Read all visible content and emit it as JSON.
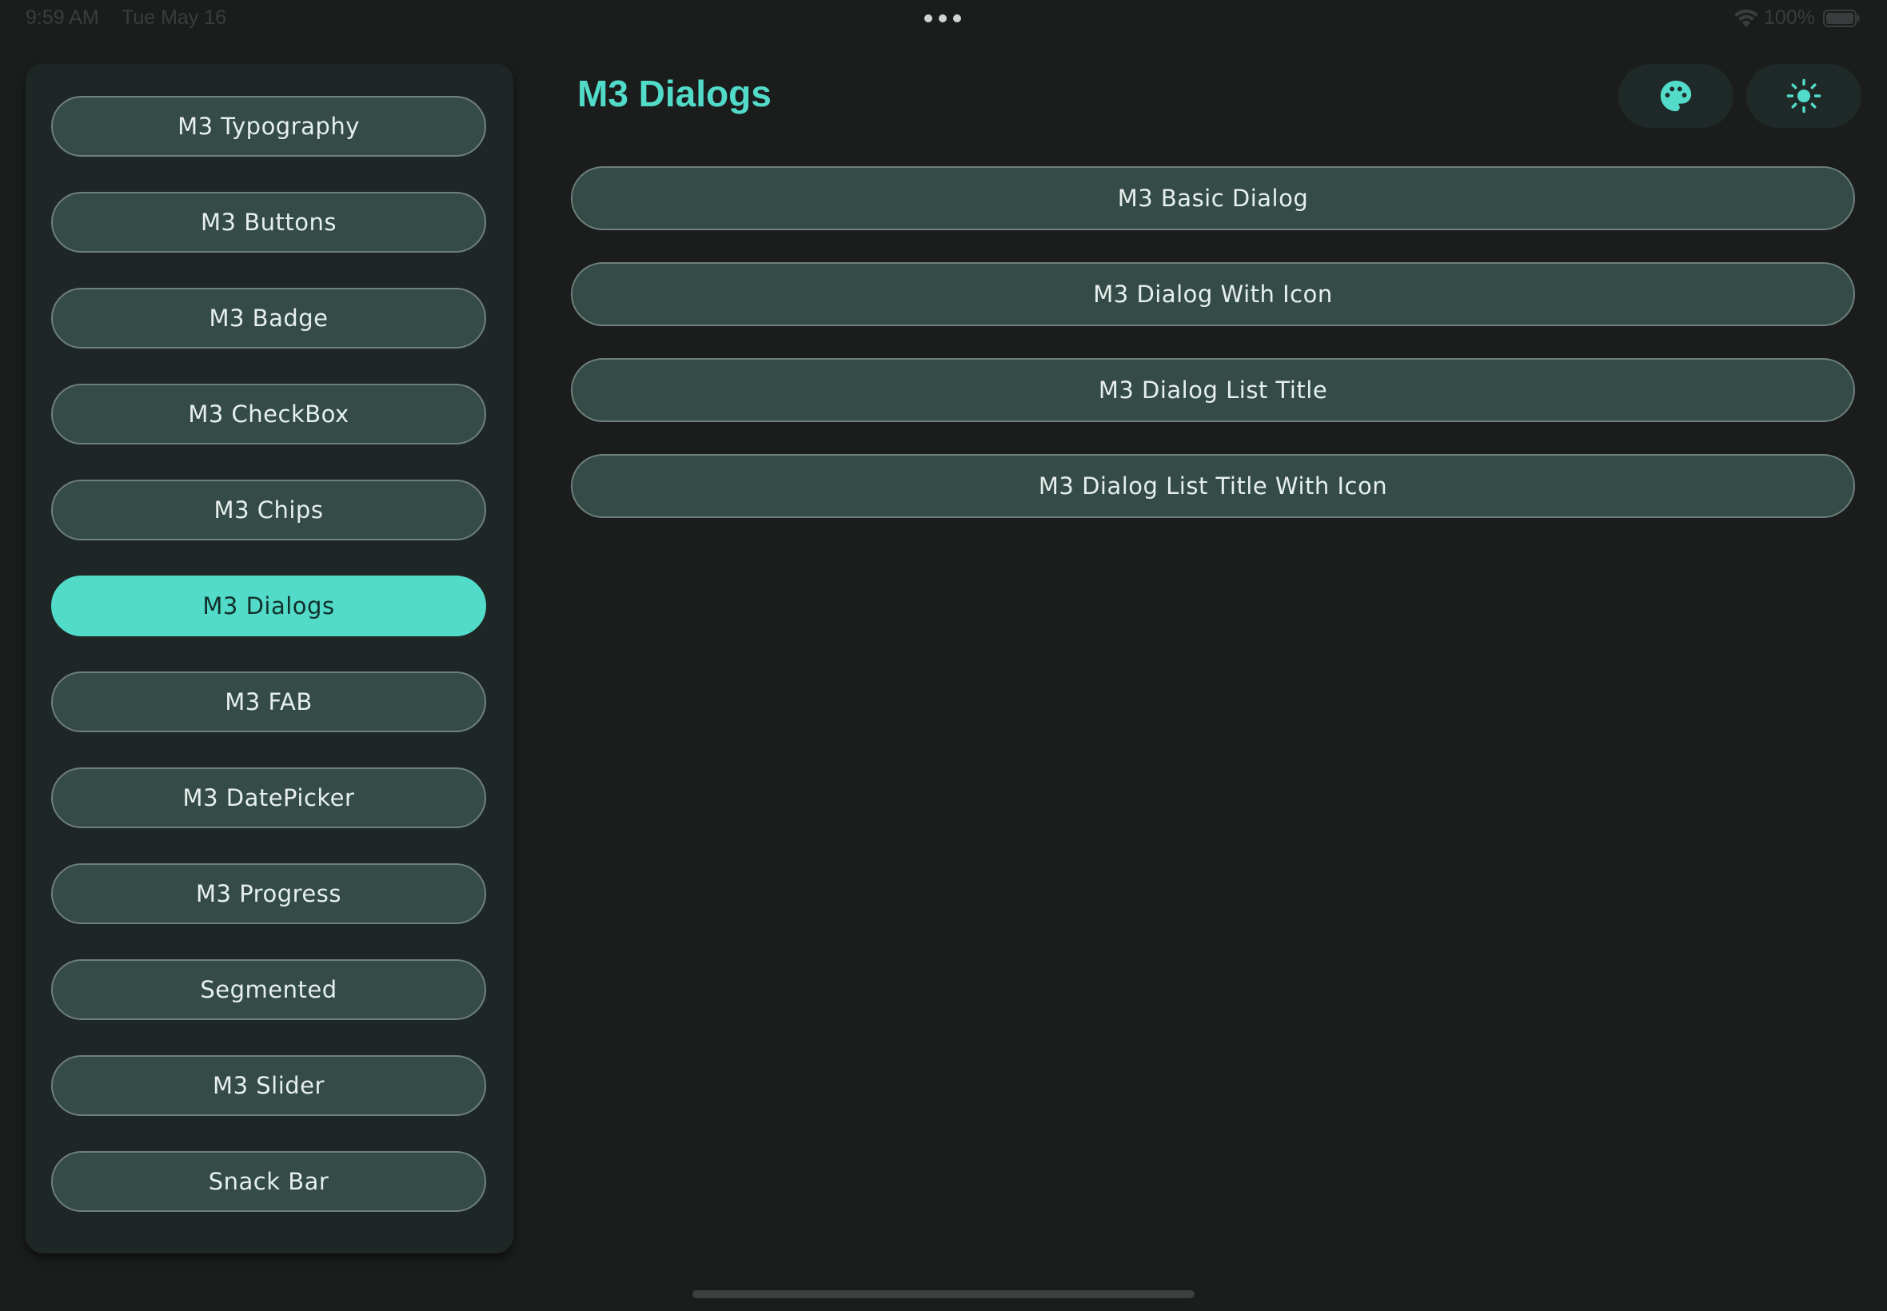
{
  "status_bar": {
    "time": "9:59 AM",
    "date": "Tue May 16",
    "battery": "100%"
  },
  "sidebar": {
    "items": [
      {
        "label": "M3 Typography",
        "active": false
      },
      {
        "label": "M3 Buttons",
        "active": false
      },
      {
        "label": "M3 Badge",
        "active": false
      },
      {
        "label": "M3 CheckBox",
        "active": false
      },
      {
        "label": "M3 Chips",
        "active": false
      },
      {
        "label": "M3 Dialogs",
        "active": true
      },
      {
        "label": "M3 FAB",
        "active": false
      },
      {
        "label": "M3 DatePicker",
        "active": false
      },
      {
        "label": "M3 Progress",
        "active": false
      },
      {
        "label": "Segmented",
        "active": false
      },
      {
        "label": "M3 Slider",
        "active": false
      },
      {
        "label": "Snack Bar",
        "active": false
      }
    ]
  },
  "main": {
    "title": "M3 Dialogs",
    "top_actions": [
      {
        "icon": "palette-icon"
      },
      {
        "icon": "brightness-icon"
      }
    ],
    "dialog_buttons": [
      {
        "label": "M3 Basic Dialog"
      },
      {
        "label": "M3 Dialog With Icon"
      },
      {
        "label": "M3 Dialog List Title"
      },
      {
        "label": "M3 Dialog List Title With Icon"
      }
    ]
  },
  "colors": {
    "background": "#1b1d1d",
    "sidebar": "#1f2726",
    "button": "#344b47",
    "accent": "#52dbc9"
  }
}
